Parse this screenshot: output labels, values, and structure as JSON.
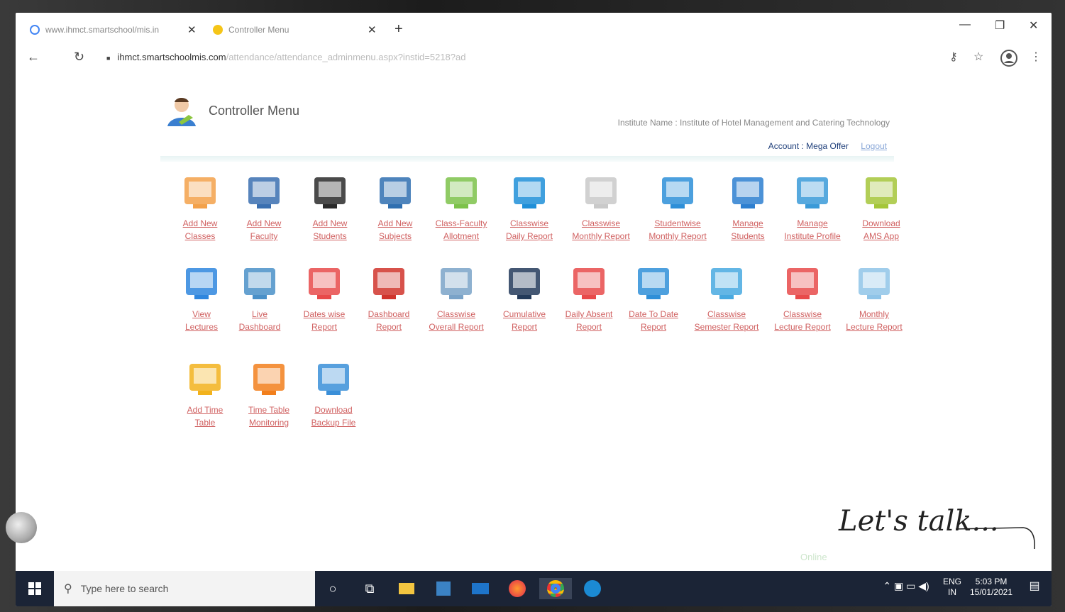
{
  "browser": {
    "tabs": [
      {
        "title": "www.ihmct.smartschool/mis.in"
      },
      {
        "title": "Controller Menu"
      }
    ],
    "url_host": "ihmct.smartschoolmis.com",
    "url_path": "/attendance/attendance_adminmenu.aspx?instid=5218?ad"
  },
  "page": {
    "title": "Controller Menu",
    "institute_label": "Institute Name :",
    "institute_name": "Institute of Hotel Management and Catering Technology",
    "account_label": "Account : Mega Offer",
    "logout": "Logout"
  },
  "menu": [
    {
      "label": "Add New\nClasses",
      "icon": "whiteboard-icon"
    },
    {
      "label": "Add New\nFaculty",
      "icon": "faculty-group-icon"
    },
    {
      "label": "Add New\nStudents",
      "icon": "student-icon"
    },
    {
      "label": "Add New\nSubjects",
      "icon": "book-icon"
    },
    {
      "label": "Class-Faculty\nAllotment",
      "icon": "org-chart-icon"
    },
    {
      "label": "Classwise\nDaily Report",
      "icon": "clock-icon"
    },
    {
      "label": "Classwise\nMonthly Report",
      "icon": "calendar-clock-icon"
    },
    {
      "label": "Studentwise\nMonthly Report",
      "icon": "calendar-icon"
    },
    {
      "label": "Manage\nStudents",
      "icon": "manage-student-icon"
    },
    {
      "label": "Manage\nInstitute Profile",
      "icon": "globe-monitor-icon"
    },
    {
      "label": "Download\nAMS App",
      "icon": "android-icon"
    },
    {
      "label": "View\nLectures",
      "icon": "monitor-chart-icon"
    },
    {
      "label": "Live\nDashboard",
      "icon": "live-chart-icon"
    },
    {
      "label": "Dates wise\nReport",
      "icon": "dates-report-icon"
    },
    {
      "label": "Dashboard\nReport",
      "icon": "dashboard-report-icon"
    },
    {
      "label": "Classwise\nOverall Report",
      "icon": "calculator-icon"
    },
    {
      "label": "Cumulative\nReport",
      "icon": "cumulative-chart-icon"
    },
    {
      "label": "Daily  Absent\nReport",
      "icon": "bar-trend-icon"
    },
    {
      "label": "Date To Date\nReport",
      "icon": "date-range-icon"
    },
    {
      "label": "Classwise\nSemester Report",
      "icon": "document-icon"
    },
    {
      "label": "Classwise\nLecture Report",
      "icon": "bar-chart-icon"
    },
    {
      "label": "Monthly\nLecture Report",
      "icon": "report-sheet-icon"
    },
    {
      "label": "Add Time\nTable",
      "icon": "clock-gear-icon"
    },
    {
      "label": "Time Table\nMonitoring",
      "icon": "gauge-icon"
    },
    {
      "label": "Download\nBackup File",
      "icon": "database-download-icon"
    }
  ],
  "overlay": {
    "lets_talk": "Let's talk...",
    "online": "Online"
  },
  "taskbar": {
    "search_placeholder": "Type here to search",
    "lang1": "ENG",
    "lang2": "IN",
    "time": "5:03 PM",
    "date": "15/01/2021"
  }
}
